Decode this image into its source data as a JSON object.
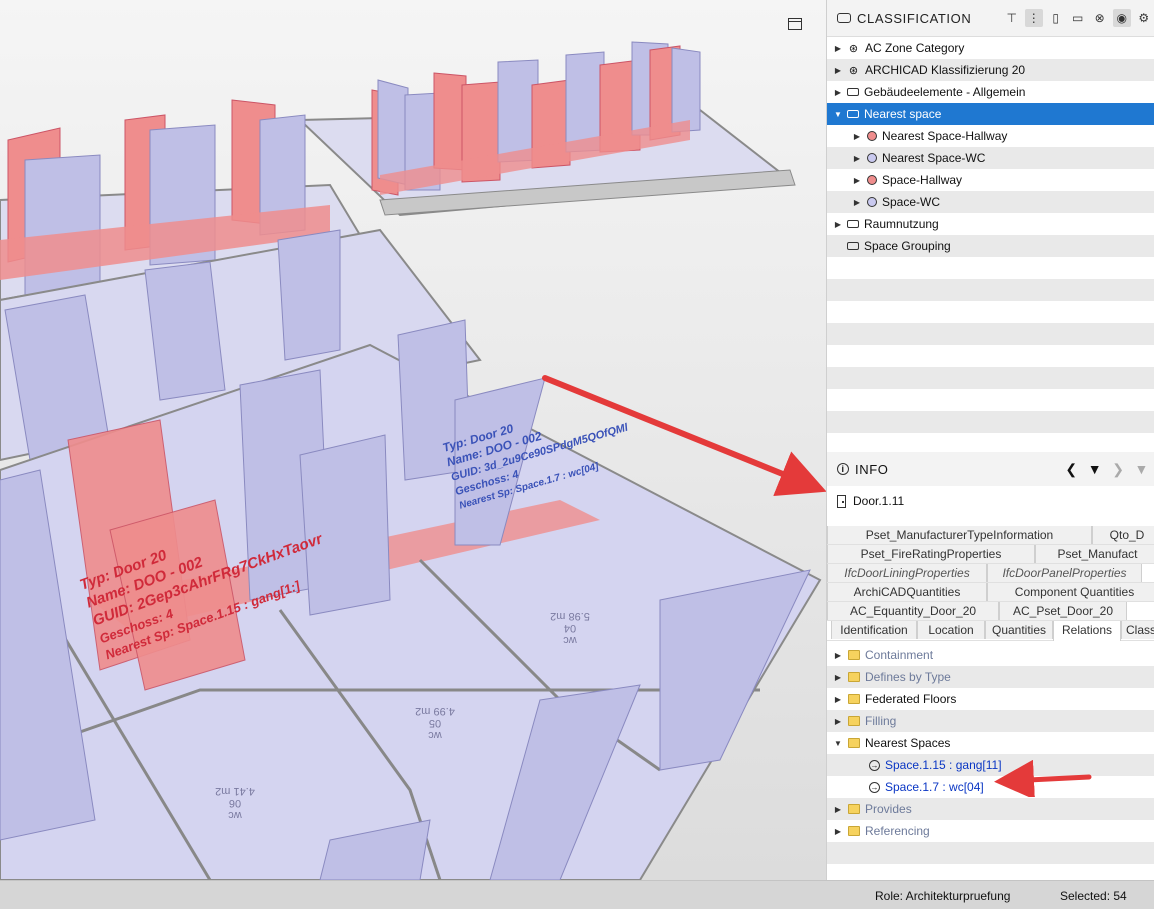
{
  "viewport": {
    "annotation_red": {
      "typ": "Typ: Door 20",
      "name": "Name: DOO - 002",
      "guid": "GUID: 2Gep3cAhrFRg7CkHxTaovr",
      "geschoss": "Geschoss: 4",
      "nearest": "Nearest Sp: Space.1.15 : gang[1:]"
    },
    "annotation_blue": {
      "typ": "Typ: Door 20",
      "name": "Name: DOO - 002",
      "guid": "GUID: 3d_2u9Ce90SPdgM5QOfQMl",
      "geschoss": "Geschoss: 4",
      "nearest": "Nearest Sp: Space.1.7 : wc[04]"
    },
    "floor_labels": [
      {
        "l1": "wc",
        "l2": "04",
        "l3": "5.98 m2"
      },
      {
        "l1": "wc",
        "l2": "05",
        "l3": "4.99 m2"
      },
      {
        "l1": "wc",
        "l2": "06",
        "l3": "4.41 m2"
      }
    ],
    "colors": {
      "door_red": "#ef8d8d",
      "door_blue": "#b9b9e6",
      "floor": "#d4d4f0",
      "arrow": "#e43a3a"
    }
  },
  "classification": {
    "title": "CLASSIFICATION",
    "toolbar_icons": [
      "tree-structure-icon",
      "hierarchy-icon",
      "new-file-icon",
      "open-folder-icon",
      "clear-icon",
      "visibility-icon",
      "settings-icon"
    ],
    "items": [
      {
        "label": "AC Zone Category",
        "icon": "classification-system-icon",
        "expanded": false,
        "indent": 0
      },
      {
        "label": "ARCHICAD Klassifizierung 20",
        "icon": "classification-system-icon",
        "expanded": false,
        "indent": 0
      },
      {
        "label": "Gebäudeelemente - Allgemein",
        "icon": "tag-icon",
        "expanded": false,
        "indent": 0
      },
      {
        "label": "Nearest space",
        "icon": "tag-icon",
        "expanded": true,
        "indent": 0,
        "selected": true
      },
      {
        "label": "Nearest Space-Hallway",
        "icon": "red-circle-icon",
        "expanded": false,
        "indent": 1
      },
      {
        "label": "Nearest Space-WC",
        "icon": "blue-circle-icon",
        "expanded": false,
        "indent": 1
      },
      {
        "label": "Space-Hallway",
        "icon": "red-circle-icon",
        "expanded": false,
        "indent": 1
      },
      {
        "label": "Space-WC",
        "icon": "blue-circle-icon",
        "expanded": false,
        "indent": 1
      },
      {
        "label": "Raumnutzung",
        "icon": "tag-icon",
        "expanded": false,
        "indent": 0
      },
      {
        "label": "Space Grouping",
        "icon": "tag-icon",
        "expanded": null,
        "indent": 0
      }
    ]
  },
  "info": {
    "title": "INFO",
    "object": "Door.1.11",
    "property_tabs": {
      "row1": [
        "Pset_ManufacturerTypeInformation",
        "Qto_D"
      ],
      "row2": [
        "Pset_FireRatingProperties",
        "Pset_Manufact"
      ],
      "row3": [
        "IfcDoorLiningProperties",
        "IfcDoorPanelProperties"
      ],
      "row4": [
        "ArchiCADQuantities",
        "Component Quantities"
      ],
      "row5": [
        "AC_Equantity_Door_20",
        "AC_Pset_Door_20"
      ],
      "row6": [
        "Identification",
        "Location",
        "Quantities",
        "Relations",
        "Class"
      ]
    },
    "active_tab": "Relations",
    "relations": [
      {
        "label": "Containment",
        "muted": true
      },
      {
        "label": "Defines by Type",
        "muted": true
      },
      {
        "label": "Federated Floors",
        "muted": false
      },
      {
        "label": "Filling",
        "muted": true
      },
      {
        "label": "Nearest Spaces",
        "muted": false,
        "expanded": true,
        "children": [
          "Space.1.15 : gang[11]",
          "Space.1.7 : wc[04]"
        ]
      },
      {
        "label": "Provides",
        "muted": true
      },
      {
        "label": "Referencing",
        "muted": true
      }
    ]
  },
  "status": {
    "role": "Role: Architekturpruefung",
    "selected": "Selected: 54"
  }
}
